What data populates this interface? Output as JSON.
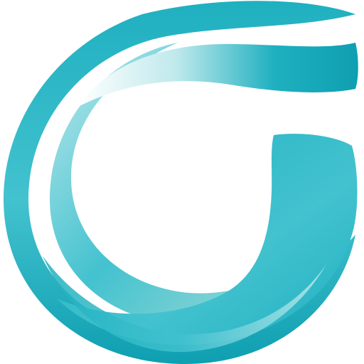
{
  "logo": {
    "icon": "swirl-letter-g-icon",
    "colors": {
      "background": "#ffffff",
      "teal_light": "#bfe9ec",
      "teal_mid": "#43c2cf",
      "teal": "#1fb0c0",
      "teal_dark": "#0e9fb1",
      "mint": "#a8ddd6",
      "highlight": "#ffffff"
    }
  }
}
